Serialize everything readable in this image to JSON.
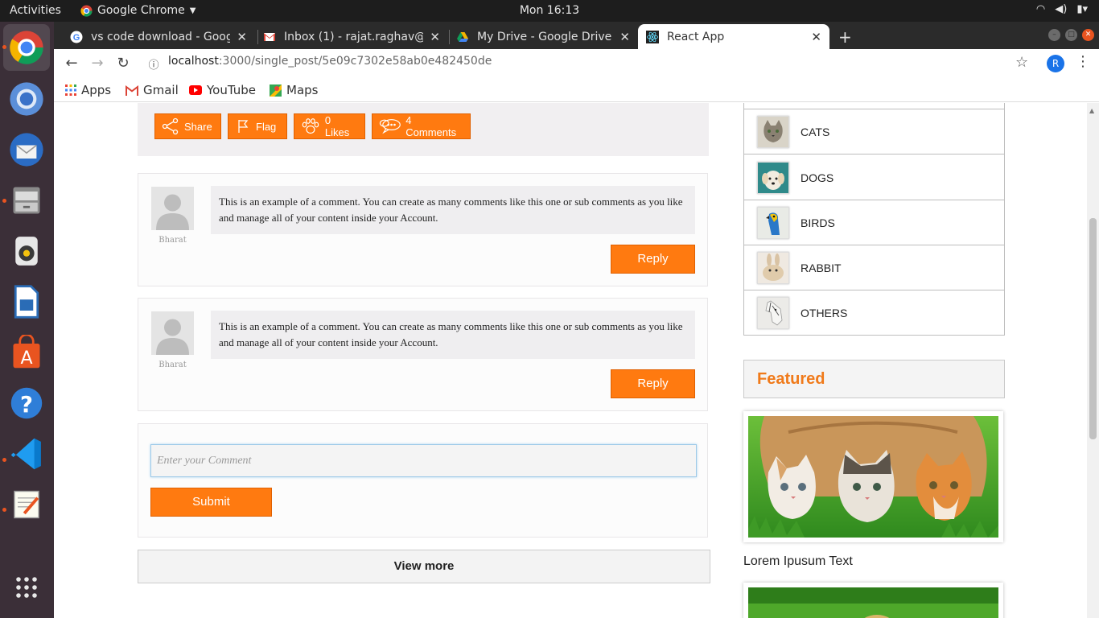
{
  "system": {
    "activities": "Activities",
    "app_name": "Google Chrome",
    "clock": "Mon 16:13"
  },
  "dock": {
    "items": [
      "chrome",
      "chromium",
      "thunderbird",
      "files",
      "rhythmbox",
      "writer",
      "software-center",
      "help",
      "vscode",
      "text-editor"
    ],
    "show_apps": "show-applications"
  },
  "browser": {
    "tabs": [
      {
        "label": "vs code download - Googl",
        "icon": "google-icon"
      },
      {
        "label": "Inbox (1) - rajat.raghav@c",
        "icon": "gmail-icon"
      },
      {
        "label": "My Drive - Google Drive",
        "icon": "drive-icon"
      },
      {
        "label": "React App",
        "icon": "react-icon"
      }
    ],
    "url_host": "localhost",
    "url_path": ":3000/single_post/5e09c7302e58ab0e482450de",
    "profile_initial": "R",
    "bookmarks": [
      "Apps",
      "Gmail",
      "YouTube",
      "Maps"
    ]
  },
  "post": {
    "actions": {
      "share": "Share",
      "flag": "Flag",
      "likes": "0 Likes",
      "comments": "4 Comments"
    },
    "comments": [
      {
        "author": "Bharat",
        "text": "This is an example of a comment. You can create as many comments like this one or sub comments as you like and manage all of your content inside your Account.",
        "reply_label": "Reply"
      },
      {
        "author": "Bharat",
        "text": "This is an example of a comment. You can create as many comments like this one or sub comments as you like and manage all of your content inside your Account.",
        "reply_label": "Reply"
      }
    ],
    "comment_placeholder": "Enter your Comment",
    "submit_label": "Submit",
    "view_more": "View more"
  },
  "sidebar": {
    "categories": [
      "CATS",
      "DOGS",
      "BIRDS",
      "RABBIT",
      "OTHERS"
    ],
    "featured_title": "Featured",
    "featured_caption": "Lorem Ipusum Text"
  },
  "colors": {
    "accent": "#ff7a10",
    "featured": "#f07a1a",
    "ubuntu_orange": "#e95420"
  }
}
